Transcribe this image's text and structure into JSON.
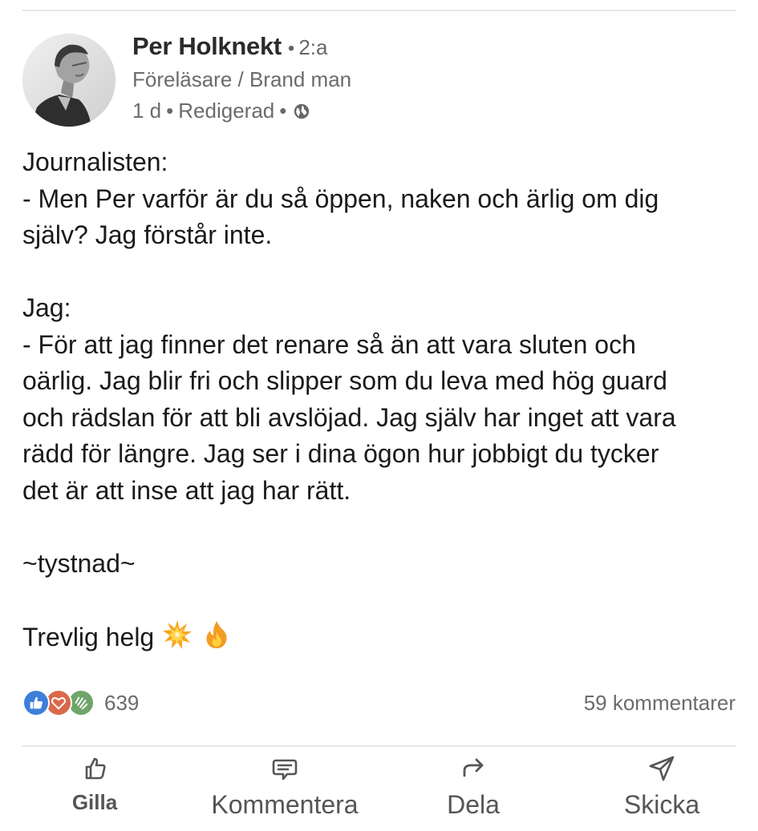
{
  "post": {
    "author": {
      "name": "Per Holknekt",
      "connection_degree": "2:a",
      "separator": "•",
      "headline": "Föreläsare / Brand man",
      "time": "1 d",
      "edited": "Redigerad",
      "visibility_icon": "globe-icon"
    },
    "body": {
      "p1_line1": "Journalisten:",
      "p1_line2": "- Men Per varför är du så öppen, naken och ärlig om dig",
      "p1_line3": "själv? Jag förstår inte.",
      "p2_line1": "Jag:",
      "p2_line2": "- För att jag finner det renare så än att vara sluten och",
      "p2_line3": "oärlig. Jag blir fri och slipper som du leva med hög guard",
      "p2_line4": "och rädslan för att bli avslöjad. Jag själv har inget att vara",
      "p2_line5": "rädd för längre. Jag ser i dina ögon hur jobbigt du tycker",
      "p2_line6": "det är att inse att jag har rätt.",
      "p3_line1": "~tystnad~",
      "p4_text": "Trevlig helg",
      "p4_emojis": [
        "collision-emoji",
        "fire-emoji"
      ]
    },
    "social": {
      "reaction_icons": [
        "like-icon",
        "love-icon",
        "celebrate-icon"
      ],
      "reaction_count": "639",
      "comments": "59 kommentarer"
    },
    "actions": {
      "like": "Gilla",
      "comment": "Kommentera",
      "share": "Dela",
      "send": "Skicka"
    }
  },
  "colors": {
    "like_reaction": "#3d7fd9",
    "love_reaction": "#d9694a",
    "celebrate_reaction": "#6fa56b",
    "secondary_text": "#6b6b6b"
  }
}
